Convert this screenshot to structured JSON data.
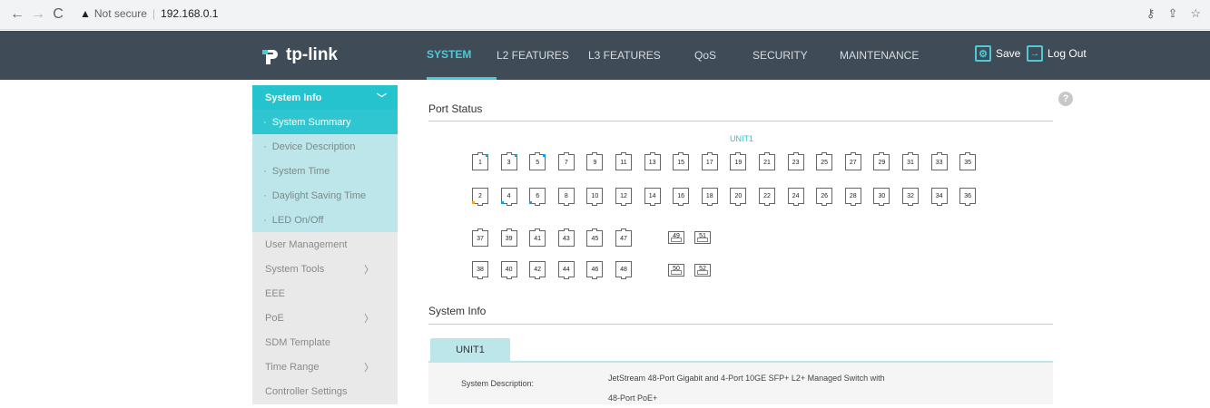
{
  "browser": {
    "security_label": "Not secure",
    "url": "192.168.0.1"
  },
  "header": {
    "brand": "tp-link",
    "tabs": [
      "SYSTEM",
      "L2 FEATURES",
      "L3 FEATURES",
      "QoS",
      "SECURITY",
      "MAINTENANCE"
    ],
    "active_tab": "SYSTEM",
    "save_label": "Save",
    "logout_label": "Log Out",
    "accent_color": "#4acbd6",
    "bg_color": "#3f4b57"
  },
  "sidebar": {
    "group_label": "System Info",
    "sub_items": [
      "System Summary",
      "Device Description",
      "System Time",
      "Daylight Saving Time",
      "LED On/Off"
    ],
    "active_sub": "System Summary",
    "items": [
      {
        "label": "User Management",
        "has_arrow": false
      },
      {
        "label": "System Tools",
        "has_arrow": true
      },
      {
        "label": "EEE",
        "has_arrow": false
      },
      {
        "label": "PoE",
        "has_arrow": true
      },
      {
        "label": "SDM Template",
        "has_arrow": false
      },
      {
        "label": "Time Range",
        "has_arrow": true
      },
      {
        "label": "Controller Settings",
        "has_arrow": false
      }
    ]
  },
  "port_status": {
    "title": "Port Status",
    "unit_label": "UNIT1",
    "top_row": [
      "1",
      "3",
      "5",
      "7",
      "9",
      "11",
      "13",
      "15",
      "17",
      "19",
      "21",
      "23",
      "25",
      "27",
      "29",
      "31",
      "33",
      "35"
    ],
    "bottom_row": [
      "2",
      "4",
      "6",
      "8",
      "10",
      "12",
      "14",
      "16",
      "18",
      "20",
      "22",
      "24",
      "26",
      "28",
      "30",
      "32",
      "34",
      "36"
    ],
    "top_row2": [
      "37",
      "39",
      "41",
      "43",
      "45",
      "47"
    ],
    "bottom_row2": [
      "38",
      "40",
      "42",
      "44",
      "46",
      "48"
    ],
    "sfp_top": [
      "49",
      "51"
    ],
    "sfp_bottom": [
      "50",
      "52"
    ],
    "link_colors": {
      "1": "#1a9ed9",
      "3": "#1a9ed9",
      "5": "#1a9ed9",
      "2": "#f5a623",
      "4": "#1a9ed9",
      "6": "#1a9ed9"
    }
  },
  "system_info": {
    "title": "System Info",
    "unit_tab": "UNIT1",
    "rows": [
      {
        "label": "System Description:",
        "value_line1": "JetStream 48-Port Gigabit and 4-Port 10GE SFP+ L2+ Managed Switch with",
        "value_line2": "48-Port PoE+"
      }
    ]
  }
}
